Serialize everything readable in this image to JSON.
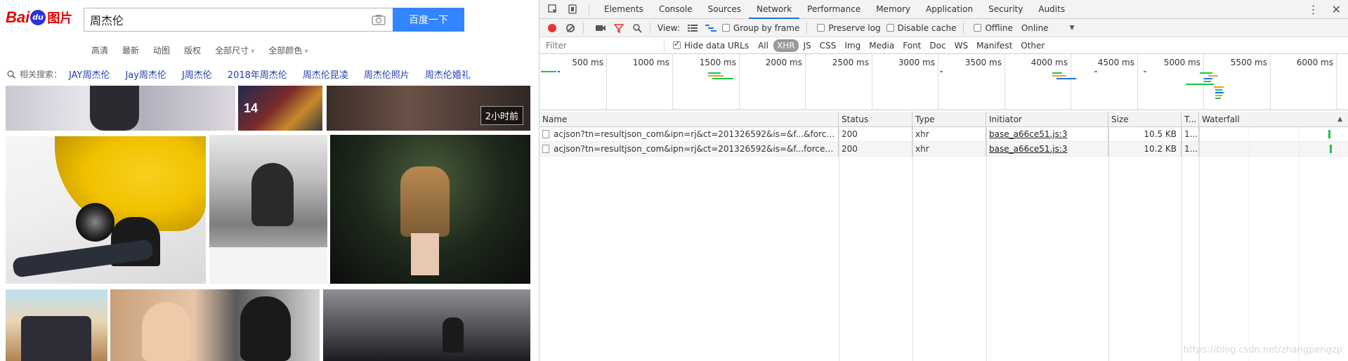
{
  "baidu": {
    "logo": {
      "bai": "Bai",
      "du": "du",
      "tupian": "图片"
    },
    "search": {
      "value": "周杰伦",
      "button": "百度一下"
    },
    "filters": [
      {
        "label": "高清",
        "dropdown": false
      },
      {
        "label": "最新",
        "dropdown": false
      },
      {
        "label": "动图",
        "dropdown": false
      },
      {
        "label": "版权",
        "dropdown": false
      },
      {
        "label": "全部尺寸",
        "dropdown": true
      },
      {
        "label": "全部颜色",
        "dropdown": true
      }
    ],
    "related": {
      "label": "相关搜索：",
      "items": [
        "JAY周杰伦",
        "Jay周杰伦",
        "J周杰伦",
        "2018年周杰伦",
        "周杰伦昆凌",
        "周杰伦照片",
        "周杰伦婚礼"
      ]
    },
    "image_caption": "2小时前"
  },
  "devtools": {
    "tabs": [
      "Elements",
      "Console",
      "Sources",
      "Network",
      "Performance",
      "Memory",
      "Application",
      "Security",
      "Audits"
    ],
    "active_tab": "Network",
    "toolbar": {
      "view_label": "View:",
      "group_by_frame": "Group by frame",
      "preserve_log": "Preserve log",
      "disable_cache": "Disable cache",
      "offline": "Offline",
      "throttle": "Online"
    },
    "filter": {
      "placeholder": "Filter",
      "hide_data_urls": "Hide data URLs",
      "types": [
        "All",
        "XHR",
        "JS",
        "CSS",
        "Img",
        "Media",
        "Font",
        "Doc",
        "WS",
        "Manifest",
        "Other"
      ],
      "active_type": "XHR"
    },
    "timeline_labels": [
      "500 ms",
      "1000 ms",
      "1500 ms",
      "2000 ms",
      "2500 ms",
      "3000 ms",
      "3500 ms",
      "4000 ms",
      "4500 ms",
      "5000 ms",
      "5500 ms",
      "6000 ms"
    ],
    "columns": [
      "Name",
      "Status",
      "Type",
      "Initiator",
      "Size",
      "T...",
      "Waterfall"
    ],
    "rows": [
      {
        "name": "acjson?tn=resultjson_com&ipn=rj&ct=201326592&is=&f...&force=&cg=...",
        "status": "200",
        "type": "xhr",
        "initiator": "base_a66ce51.js:3",
        "size": "10.5 KB",
        "time": "1..."
      },
      {
        "name": "acjson?tn=resultjson_com&ipn=rj&ct=201326592&is=&f...force=&cg=st...",
        "status": "200",
        "type": "xhr",
        "initiator": "base_a66ce51.js:3",
        "size": "10.2 KB",
        "time": "1..."
      }
    ],
    "watermark": "https://blog.csdn.net/zhangpengzp",
    "colors": {
      "accent": "#1a73e8",
      "record": "#ee3333",
      "waterfall": "#1dc44b"
    }
  }
}
